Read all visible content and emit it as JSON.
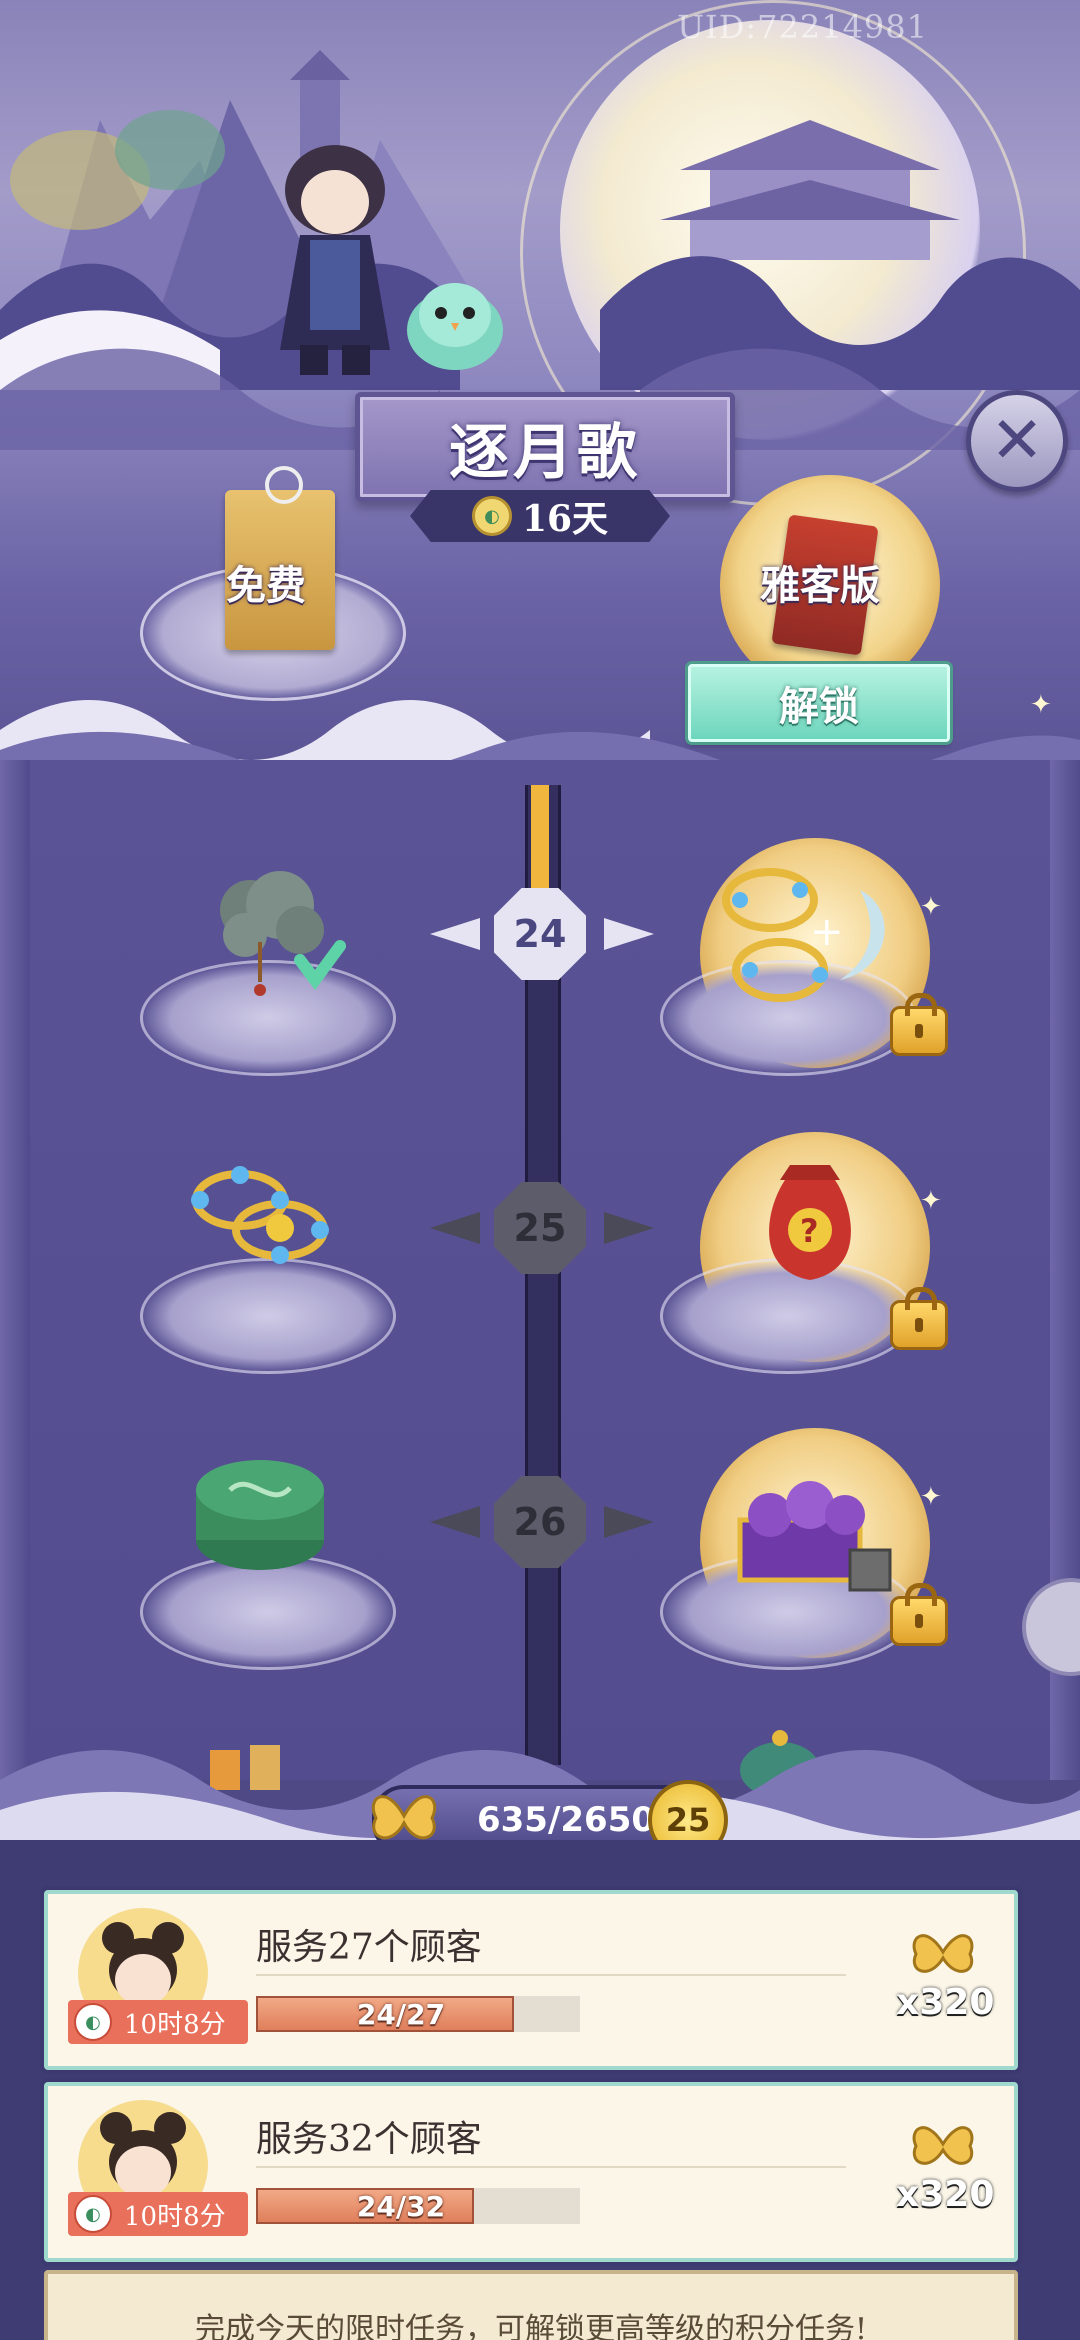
{
  "header": {
    "uid": "UID:72214981",
    "title": "逐月歌",
    "days_left": "16天"
  },
  "tiers": {
    "free_label": "免费",
    "premium_label": "雅客版",
    "unlock_label": "解锁"
  },
  "track": {
    "levels": [
      {
        "level": "24",
        "state": "active",
        "free_item": "cloud-pendant-icon",
        "free_claimed": true,
        "premium_item": "bead-bracelet-and-jade-bundle-icon",
        "premium_locked": true
      },
      {
        "level": "25",
        "state": "locked",
        "free_item": "bead-bracelet-icon",
        "free_claimed": false,
        "premium_item": "mystery-bag-icon",
        "premium_locked": true
      },
      {
        "level": "26",
        "state": "locked",
        "free_item": "green-tin-box-icon",
        "free_claimed": false,
        "premium_item": "sachet-gift-box-icon",
        "premium_locked": true
      }
    ],
    "progress_fraction": 0.2396
  },
  "xp": {
    "current": "635/2650",
    "level": "25"
  },
  "tasks": [
    {
      "title": "服务27个顾客",
      "timer": "10时8分",
      "progress_text": "24/27",
      "progress_value": 24,
      "progress_max": 27,
      "reward": "x320"
    },
    {
      "title": "服务32个顾客",
      "timer": "10时8分",
      "progress_text": "24/32",
      "progress_value": 24,
      "progress_max": 32,
      "reward": "x320"
    }
  ],
  "hint": "完成今天的限时任务，可解锁更高等级的积分任务!",
  "colors": {
    "accent_gold": "#f0b63e",
    "unlock_teal": "#6ed6bd",
    "panel_purple": "#534d8f",
    "task_orange": "#e07f5c"
  }
}
